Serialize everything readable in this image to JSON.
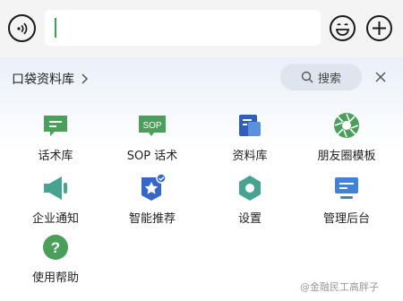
{
  "input_bar": {
    "voice_icon": "voice-icon",
    "emoji_icon": "emoji-icon",
    "plus_icon": "plus-icon"
  },
  "panel": {
    "title": "口袋资料库",
    "search_label": "搜索",
    "items": [
      {
        "label": "话术库",
        "icon": "chat-script-icon",
        "color": "#4aa05a"
      },
      {
        "label": "SOP 话术",
        "icon": "sop-icon",
        "color": "#4aa05a"
      },
      {
        "label": "资料库",
        "icon": "document-library-icon",
        "color": "#2f5fb8"
      },
      {
        "label": "朋友圈模板",
        "icon": "moments-icon",
        "color": "#4aa05a"
      },
      {
        "label": "企业通知",
        "icon": "megaphone-icon",
        "color": "#46a38f"
      },
      {
        "label": "智能推荐",
        "icon": "smart-badge-icon",
        "color": "#3567c7"
      },
      {
        "label": "设置",
        "icon": "settings-hexagon-icon",
        "color": "#46a38f"
      },
      {
        "label": "管理后台",
        "icon": "admin-monitor-icon",
        "color": "#3f82d6"
      },
      {
        "label": "使用帮助",
        "icon": "help-icon",
        "color": "#4aa05a"
      }
    ]
  },
  "watermark": "@金融民工高胖子"
}
